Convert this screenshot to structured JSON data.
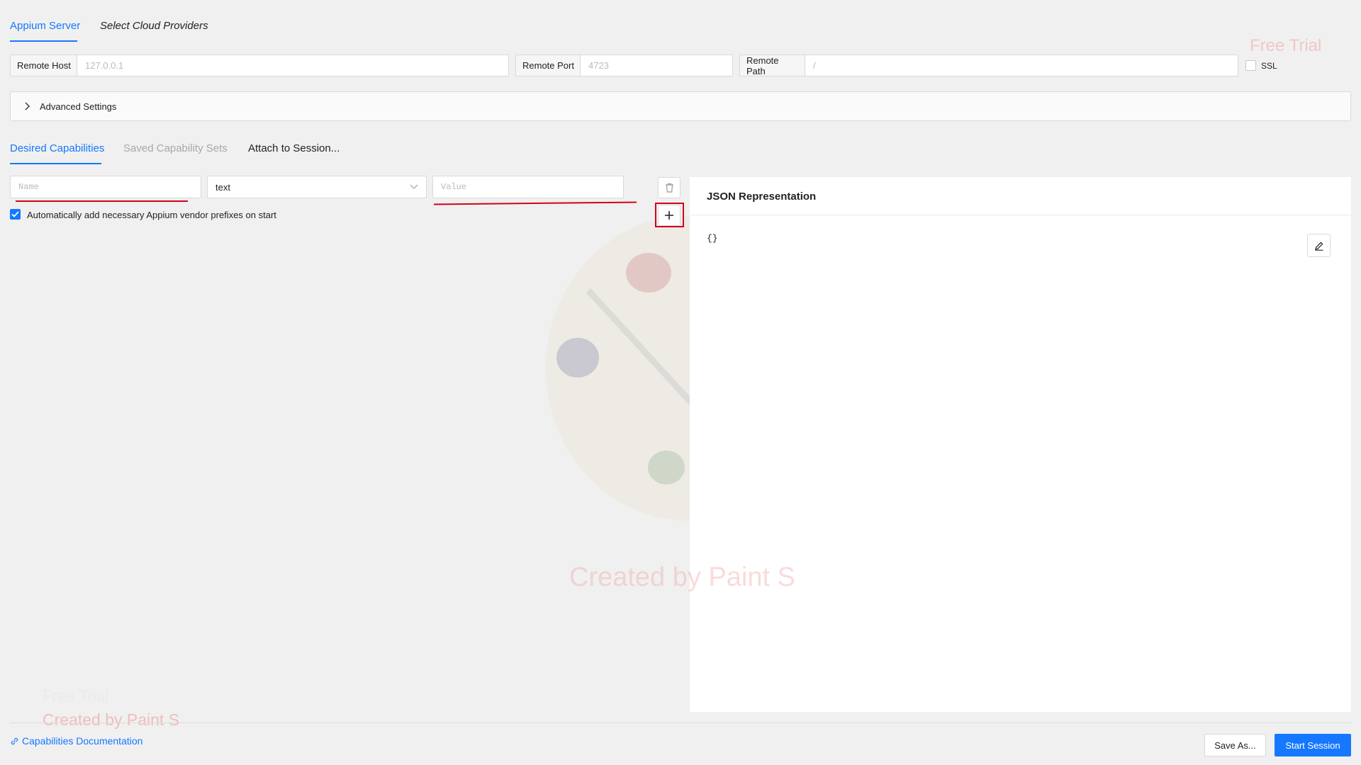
{
  "tabs": {
    "appium_server": "Appium Server",
    "cloud_providers": "Select Cloud Providers"
  },
  "server": {
    "host_label": "Remote Host",
    "host_placeholder": "127.0.0.1",
    "port_label": "Remote Port",
    "port_placeholder": "4723",
    "path_label": "Remote Path",
    "path_placeholder": "/",
    "ssl_label": "SSL",
    "ssl_checked": false
  },
  "advanced": {
    "label": "Advanced Settings"
  },
  "cap_tabs": {
    "desired": "Desired Capabilities",
    "saved": "Saved Capability Sets",
    "attach": "Attach to Session..."
  },
  "capability": {
    "name_placeholder": "Name",
    "type_value": "text",
    "value_placeholder": "Value",
    "auto_prefix_label": "Automatically add necessary Appium vendor prefixes on start",
    "auto_prefix_checked": true
  },
  "json": {
    "title": "JSON Representation",
    "content": "{}"
  },
  "footer": {
    "docs_link": "Capabilities Documentation",
    "save_as": "Save As...",
    "start_session": "Start Session"
  },
  "watermarks": {
    "top_right": "Free Trial",
    "center": "Created by Paint S",
    "bottom_left_1": "Free Trial",
    "bottom_left_2": "Created by Paint S"
  },
  "colors": {
    "accent": "#1677ff",
    "annotation_red": "#d0021b"
  }
}
